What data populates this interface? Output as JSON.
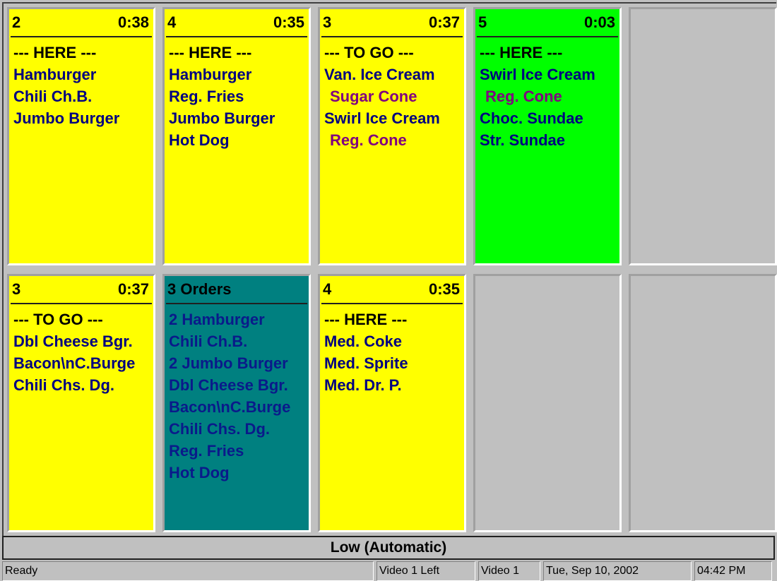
{
  "colors": {
    "pending": "#ffff00",
    "ready": "#00ff00",
    "summary": "#008080",
    "empty": "#c0c0c0",
    "item": "#000080",
    "modifier": "#800080"
  },
  "cards": [
    {
      "num": "2",
      "time": "0:38",
      "lines": [
        {
          "t": "--- HERE ---",
          "k": "label"
        },
        {
          "t": "Hamburger",
          "k": "item"
        },
        {
          "t": "Chili Ch.B.",
          "k": "item"
        },
        {
          "t": "Jumbo Burger",
          "k": "item"
        }
      ]
    },
    {
      "num": "4",
      "time": "0:35",
      "lines": [
        {
          "t": "--- HERE ---",
          "k": "label"
        },
        {
          "t": "Hamburger",
          "k": "item"
        },
        {
          "t": "Reg. Fries",
          "k": "item"
        },
        {
          "t": "Jumbo Burger",
          "k": "item"
        },
        {
          "t": "Hot Dog",
          "k": "item"
        }
      ]
    },
    {
      "num": "3",
      "time": "0:37",
      "lines": [
        {
          "t": "--- TO GO ---",
          "k": "label"
        },
        {
          "t": "Van. Ice Cream",
          "k": "item"
        },
        {
          "t": "Sugar Cone",
          "k": "mod"
        },
        {
          "t": "Swirl Ice Cream",
          "k": "item"
        },
        {
          "t": "Reg. Cone",
          "k": "mod"
        }
      ]
    },
    {
      "num": "5",
      "time": "0:03",
      "lines": [
        {
          "t": "--- HERE ---",
          "k": "label"
        },
        {
          "t": "Swirl Ice Cream",
          "k": "item"
        },
        {
          "t": "Reg. Cone",
          "k": "mod"
        },
        {
          "t": "Choc. Sundae",
          "k": "item"
        },
        {
          "t": "Str. Sundae",
          "k": "item"
        }
      ]
    },
    null,
    {
      "num": "3",
      "time": "0:37",
      "lines": [
        {
          "t": "--- TO GO ---",
          "k": "label"
        },
        {
          "t": "Dbl Cheese Bgr.",
          "k": "item"
        },
        {
          "t": "Bacon\\nC.Burge",
          "k": "item"
        },
        {
          "t": "Chili Chs. Dg.",
          "k": "item"
        }
      ]
    },
    {
      "num": "3 Orders",
      "time": "",
      "lines": [
        {
          "t": "2 Hamburger",
          "k": "item"
        },
        {
          "t": "Chili Ch.B.",
          "k": "item"
        },
        {
          "t": "2 Jumbo Burger",
          "k": "item"
        },
        {
          "t": "Dbl Cheese Bgr.",
          "k": "item"
        },
        {
          "t": "Bacon\\nC.Burge",
          "k": "item"
        },
        {
          "t": "Chili Chs. Dg.",
          "k": "item"
        },
        {
          "t": "Reg. Fries",
          "k": "item"
        },
        {
          "t": "Hot Dog",
          "k": "item"
        }
      ]
    },
    {
      "num": "4",
      "time": "0:35",
      "lines": [
        {
          "t": "--- HERE ---",
          "k": "label"
        },
        {
          "t": "Med. Coke",
          "k": "item"
        },
        {
          "t": "Med. Sprite",
          "k": "item"
        },
        {
          "t": "Med. Dr. P.",
          "k": "item"
        }
      ]
    },
    null,
    null
  ],
  "card_states": [
    "pending",
    "pending",
    "pending",
    "ready",
    "empty",
    "pending",
    "summary",
    "pending",
    "empty",
    "empty"
  ],
  "mode_bar": "Low (Automatic)",
  "status": {
    "message": "Ready",
    "video_side": "Video 1 Left",
    "video": "Video 1",
    "date": "Tue, Sep 10, 2002",
    "time": "04:42 PM"
  }
}
